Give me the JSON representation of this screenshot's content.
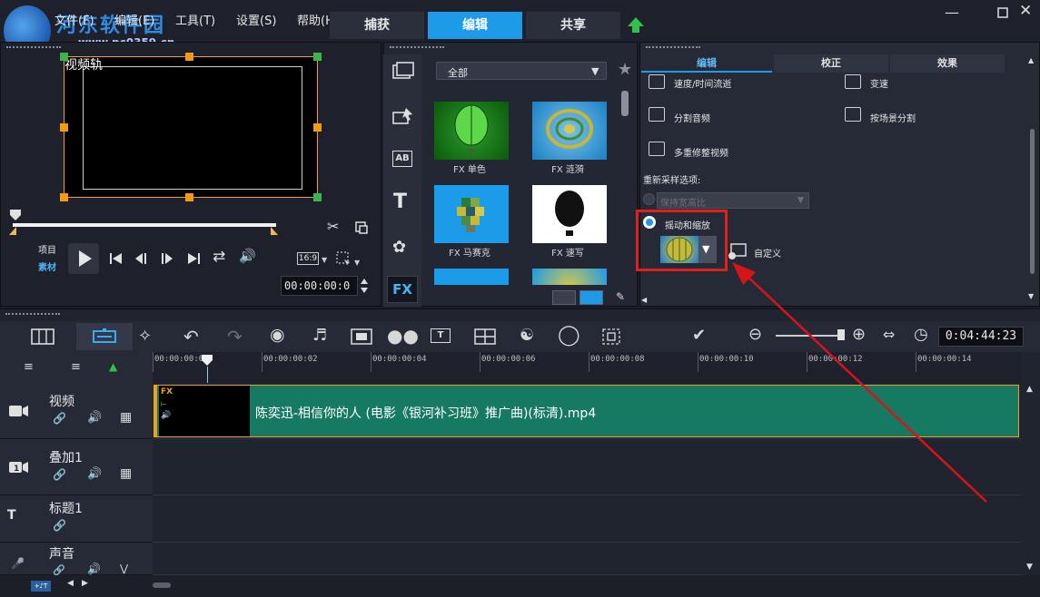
{
  "menu": [
    "文件(F)",
    "编辑(E)",
    "工具(T)",
    "设置(S)",
    "帮助(H)"
  ],
  "watermark": {
    "text": "河东软件园",
    "url": "www.pc0359.cn"
  },
  "mode_tabs": [
    {
      "label": "捕获",
      "active": false
    },
    {
      "label": "编辑",
      "active": true
    },
    {
      "label": "共享",
      "active": false
    }
  ],
  "preview": {
    "track_label": "视频轨",
    "mode_project": "项目",
    "mode_clip": "素材",
    "aspect": "16:9",
    "timecode": "00:00:00:0"
  },
  "library": {
    "filter_selected": "全部",
    "items": [
      {
        "label": "FX 单色",
        "icon": "balloon-green"
      },
      {
        "label": "FX 涟漪",
        "icon": "balloon-ripple"
      },
      {
        "label": "FX 马赛克",
        "icon": "balloon-mosaic"
      },
      {
        "label": "FX 速写",
        "icon": "balloon-sketch"
      }
    ],
    "fx_label": "FX"
  },
  "options": {
    "tabs": [
      {
        "label": "编辑",
        "active": true
      },
      {
        "label": "校正",
        "active": false
      },
      {
        "label": "效果",
        "active": false
      }
    ],
    "speed": "速度/时间流逝",
    "reverse": "变速",
    "split_audio": "分割音频",
    "split_scene": "按场景分割",
    "multi_trim": "多重修整视频",
    "resample_label": "重新采样选项:",
    "keep_ratio": "保持宽高比",
    "pan_zoom": "摇动和缩放",
    "custom": "自定义"
  },
  "timeline": {
    "duration": "0:04:44:23",
    "ruler": [
      "00:00:00:00",
      "00:00:00:02",
      "00:00:00:04",
      "00:00:00:06",
      "00:00:00:08",
      "00:00:00:10",
      "00:00:00:12",
      "00:00:00:14"
    ],
    "tracks": [
      {
        "name": "视频"
      },
      {
        "name": "叠加1"
      },
      {
        "name": "标题1"
      },
      {
        "name": "声音"
      }
    ],
    "clip_title": "陈奕迅-相信你的人 (电影《银河补习班》推广曲)(标清).mp4",
    "clip_fx": "FX"
  },
  "colors": {
    "accent": "#1e9be8",
    "clip": "#167a63",
    "highlight_box": "#e0201c",
    "arrow": "#d8141b"
  }
}
